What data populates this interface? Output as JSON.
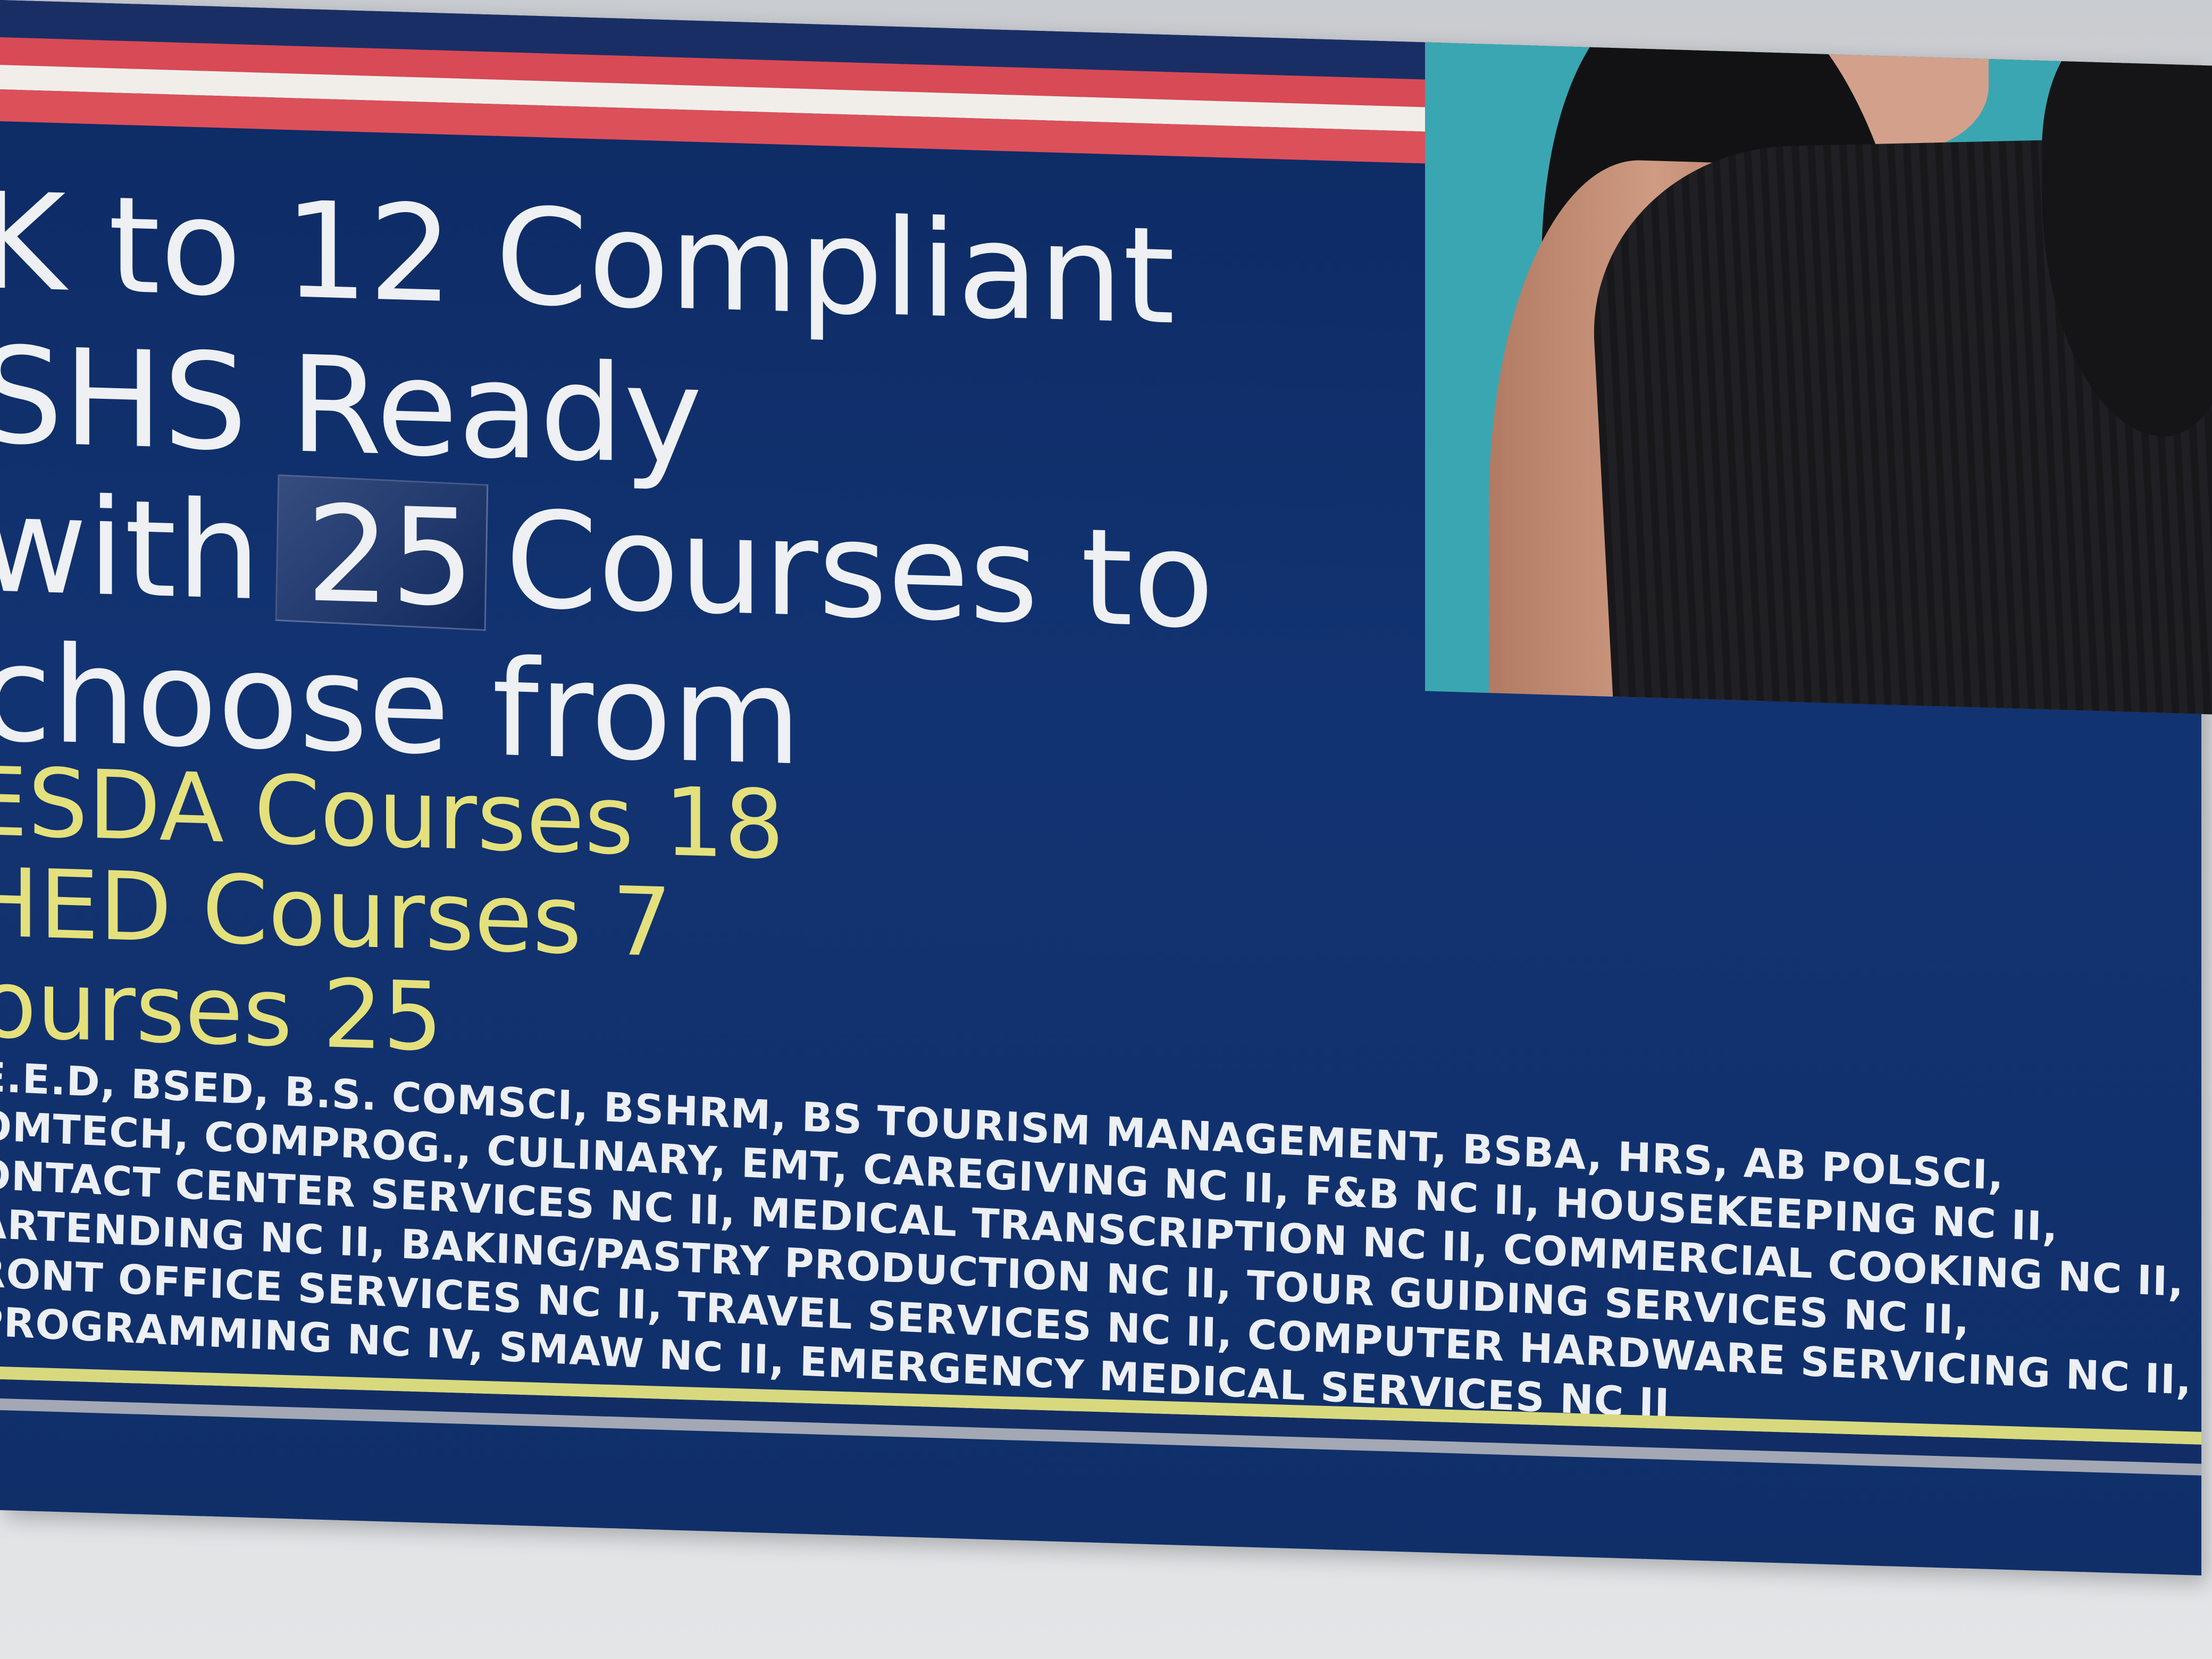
{
  "poster": {
    "headlines": [
      "K to 12 Compliant",
      "SHS Ready",
      "with",
      "25",
      "Courses to",
      "choose from"
    ],
    "tallies": [
      "ESDA Courses 18",
      "HED Courses 7",
      "ourses 25"
    ],
    "course_lines": [
      "E.E.D, BSED, B.S. COMSCI, BSHRM, BS TOURISM MANAGEMENT, BSBA, HRS, AB POLSCI,",
      "OMTECH, COMPROG., CULINARY, EMT, CAREGIVING NC II, F&B NC II, HOUSEKEEPING NC II,",
      "ONTACT CENTER SERVICES NC II, MEDICAL TRANSCRIPTION NC II, COMMERCIAL COOKING NC II,",
      "ARTENDING NC II, BAKING/PASTRY PRODUCTION NC II, TOUR GUIDING SERVICES NC II,",
      "RONT OFFICE SERVICES NC II, TRAVEL SERVICES NC II, COMPUTER HARDWARE SERVICING NC II,",
      "PROGRAMMING NC IV, SMAW  NC II, EMERGENCY MEDICAL SERVICES NC II"
    ]
  },
  "colors": {
    "poster_navy": "#123372",
    "stripe_red": "#d84a55",
    "headline_white": "#eef0f3",
    "tally_yellow": "#e4e07c",
    "photo_teal": "#3aa6b2"
  }
}
